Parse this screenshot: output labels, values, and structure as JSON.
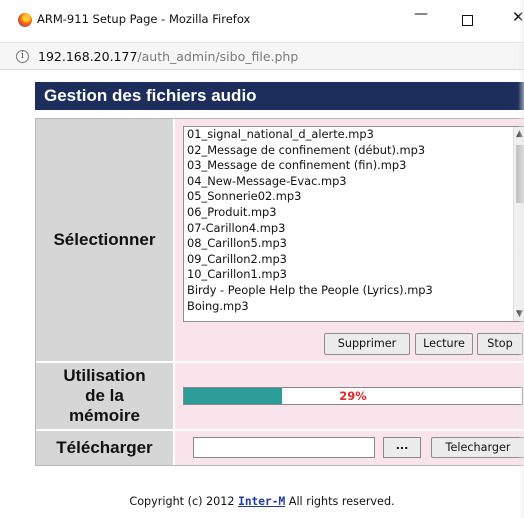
{
  "window": {
    "title": "ARM-911 Setup Page - Mozilla Firefox",
    "minimize": "—",
    "close": "✕"
  },
  "address": {
    "host": "192.168.20.177",
    "path": "/auth_admin/sibo_file.php"
  },
  "page": {
    "header": "Gestion des fichiers audio"
  },
  "select_section": {
    "label": "Sélectionner",
    "files": [
      "01_signal_national_d_alerte.mp3",
      "02_Message de confinement (début).mp3",
      "03_Message de confinement (fin).mp3",
      "04_New-Message-Evac.mp3",
      "05_Sonnerie02.mp3",
      "06_Produit.mp3",
      "07-Carillon4.mp3",
      "08_Carillon5.mp3",
      "09_Carillon2.mp3",
      "10_Carillon1.mp3",
      "Birdy - People Help the People (Lyrics).mp3",
      "Boing.mp3"
    ],
    "buttons": {
      "delete": "Supprimer",
      "play": "Lecture",
      "stop": "Stop"
    }
  },
  "memory_section": {
    "label_line1": "Utilisation",
    "label_line2": "de la",
    "label_line3": "mémoire",
    "usage_text": "29%",
    "usage_fraction": 0.29,
    "fill_color": "#2b9c98",
    "text_color": "#e0282d"
  },
  "upload_section": {
    "label": "Télécharger",
    "browse": "...",
    "upload_button": "Telecharger"
  },
  "footer": {
    "prefix": "Copyright (c) 2012 ",
    "brand": "Inter-M",
    "suffix": " All rights reserved."
  },
  "colors": {
    "header_bg": "#1d2d5c",
    "label_bg": "#d6d6d6",
    "content_bg": "#f8e4ea",
    "brand_link": "#1f3b9e"
  }
}
